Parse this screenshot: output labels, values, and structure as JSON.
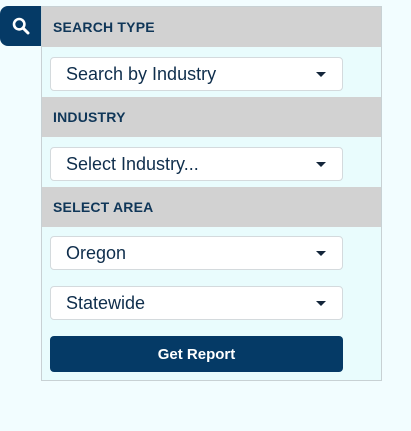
{
  "search_tab": {
    "icon": "search-icon"
  },
  "sections": {
    "search_type": {
      "header": "SEARCH TYPE",
      "selected": "Search by Industry"
    },
    "industry": {
      "header": "INDUSTRY",
      "selected": "Select Industry..."
    },
    "area": {
      "header": "SELECT AREA",
      "state_selected": "Oregon",
      "region_selected": "Statewide"
    }
  },
  "actions": {
    "get_report_label": "Get Report"
  },
  "colors": {
    "brand_navy": "#053a66",
    "header_gray": "#d2d2d2",
    "panel_bg": "#e9fcfd",
    "page_bg": "#f2fdff"
  }
}
